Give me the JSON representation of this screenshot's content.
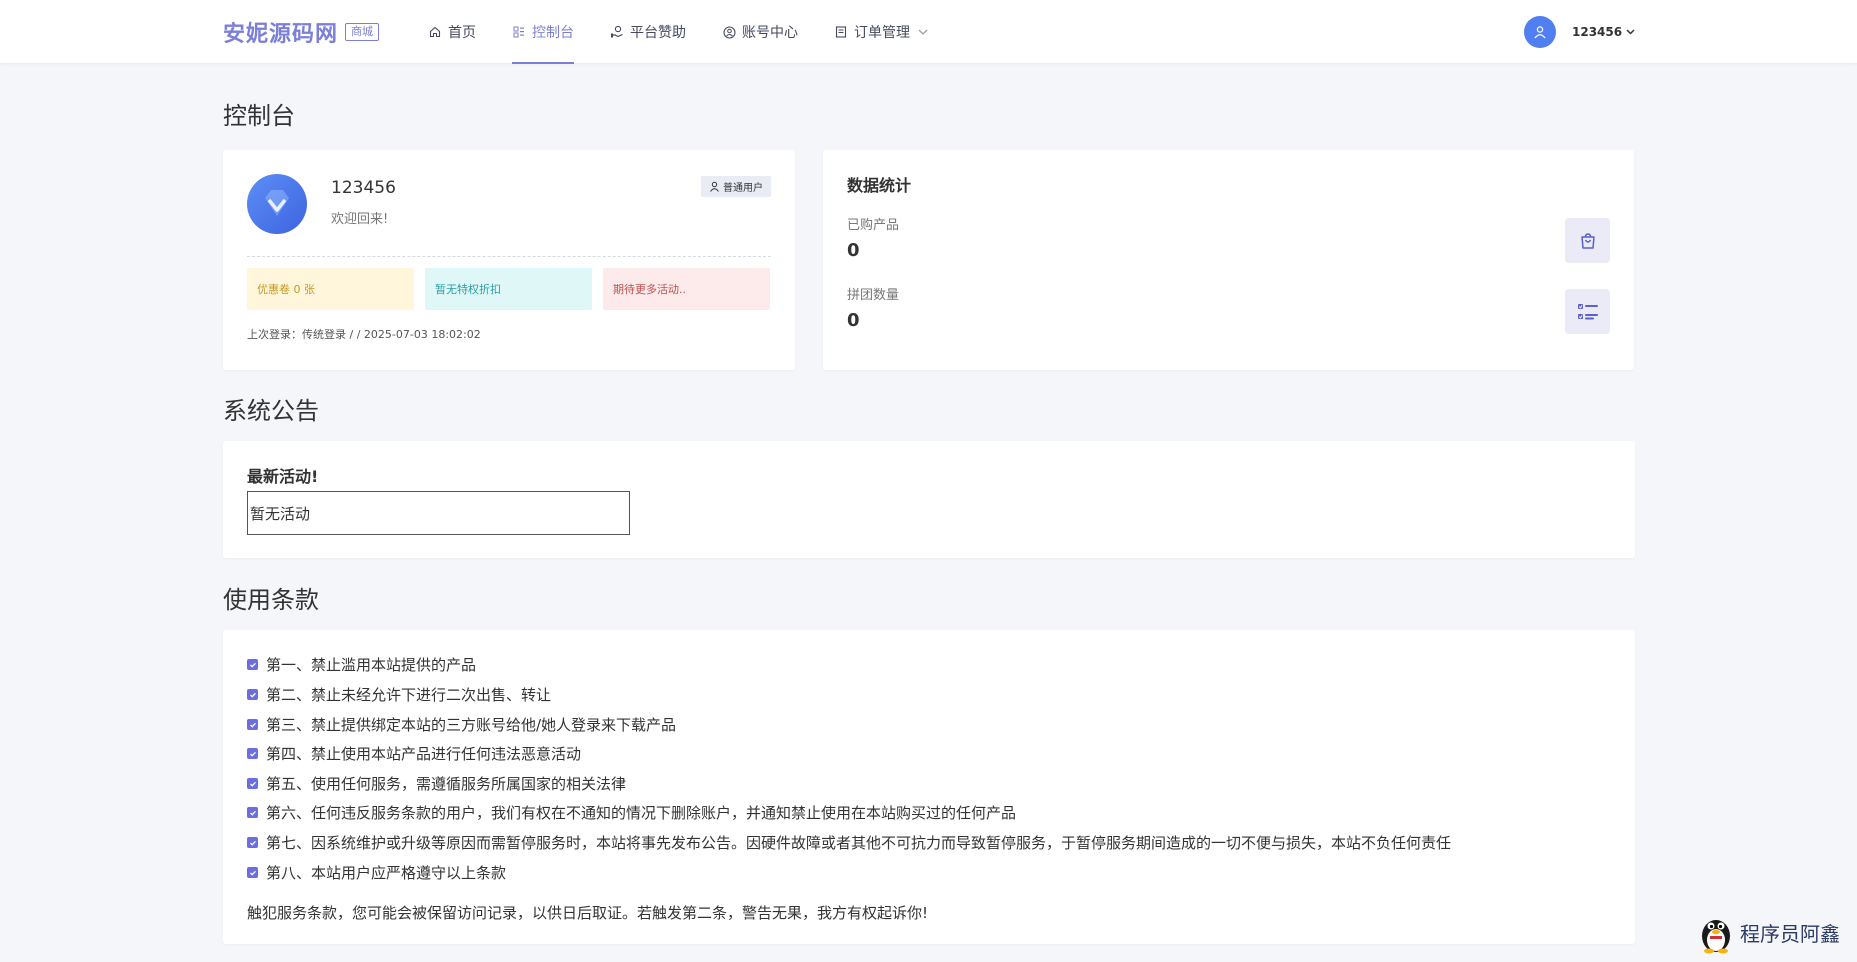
{
  "brand": {
    "name": "安妮源码网",
    "badge": "商城"
  },
  "nav": [
    {
      "label": "首页",
      "icon": "home-icon"
    },
    {
      "label": "控制台",
      "icon": "dashboard-icon",
      "active": true
    },
    {
      "label": "平台赞助",
      "icon": "donate-icon"
    },
    {
      "label": "账号中心",
      "icon": "account-icon"
    },
    {
      "label": "订单管理",
      "icon": "order-icon",
      "has_dropdown": true
    }
  ],
  "user": {
    "name": "123456"
  },
  "page_title": "控制台",
  "profile": {
    "name": "123456",
    "welcome": "欢迎回来!",
    "role": "普通用户",
    "pills": [
      "优惠卷 0 张",
      "暂无特权折扣",
      "期待更多活动.."
    ],
    "last_login": "上次登录：传统登录 / / 2025-07-03 18:02:02"
  },
  "stats": {
    "title": "数据统计",
    "items": [
      {
        "label": "已购产品",
        "value": "0",
        "icon": "shopping-bag-icon"
      },
      {
        "label": "拼团数量",
        "value": "0",
        "icon": "checklist-icon"
      }
    ]
  },
  "announcement": {
    "section_title": "系统公告",
    "title": "最新活动!",
    "content": "暂无活动"
  },
  "terms": {
    "section_title": "使用条款",
    "items": [
      "第一、禁止滥用本站提供的产品",
      "第二、禁止未经允许下进行二次出售、转让",
      "第三、禁止提供绑定本站的三方账号给他/她人登录来下载产品",
      "第四、禁止使用本站产品进行任何违法恶意活动",
      "第五、使用任何服务，需遵循服务所属国家的相关法律",
      "第六、任何违反服务条款的用户，我们有权在不通知的情况下删除账户，并通知禁止使用在本站购买过的任何产品",
      "第七、因系统维护或升级等原因而需暂停服务时，本站将事先发布公告。因硬件故障或者其他不可抗力而导致暂停服务，于暂停服务期间造成的一切不便与损失，本站不负任何责任",
      "第八、本站用户应严格遵守以上条款"
    ],
    "note": "触犯服务条款，您可能会被保留访问记录，以供日后取证。若触发第二条，警告无果，我方有权起诉你!"
  },
  "watermark": {
    "text": "程序员阿鑫"
  },
  "colors": {
    "accent": "#7b7fd9",
    "avatar": "#4f7ff0"
  }
}
